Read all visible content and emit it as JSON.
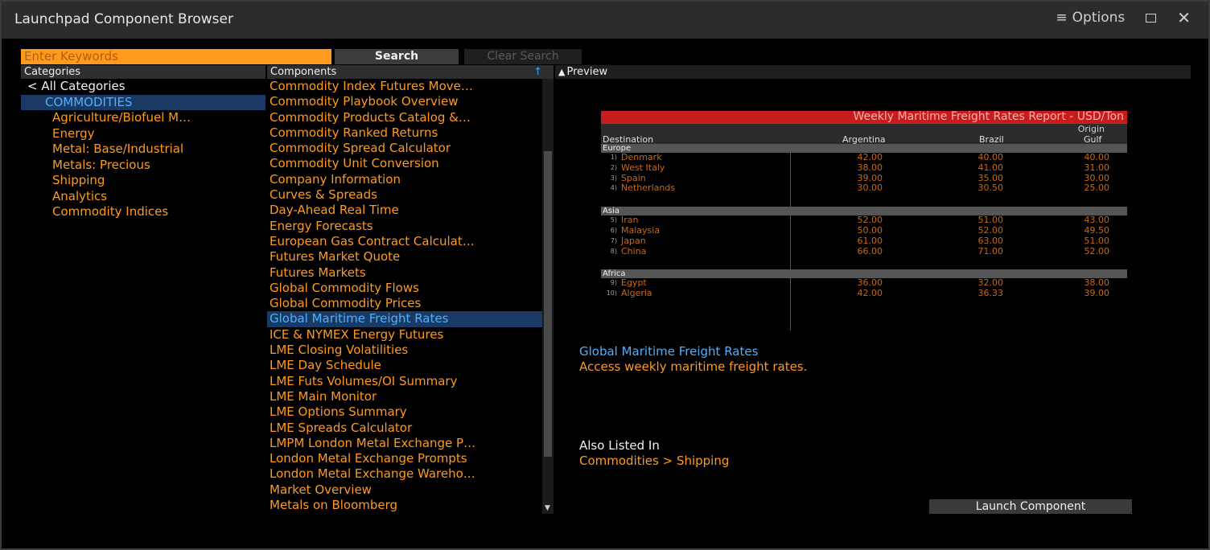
{
  "window": {
    "title": "Launchpad Component Browser",
    "options_label": "Options",
    "menu_icon": "hamburger-icon",
    "maximize_icon": "square-icon",
    "close_icon": "close-icon"
  },
  "search": {
    "placeholder": "Enter Keywords",
    "search_label": "Search",
    "clear_label": "Clear Search"
  },
  "headers": {
    "categories": "Categories",
    "components": "Components",
    "preview": "Preview",
    "sort_icon": "up-arrow-icon"
  },
  "categories": {
    "back": "< All Categories",
    "selected": "COMMODITIES",
    "items": [
      "Agriculture/Biofuel M…",
      "Energy",
      "Metal: Base/Industrial",
      "Metals: Precious",
      "Shipping",
      "Analytics",
      "Commodity Indices"
    ]
  },
  "components": {
    "selected_index": 15,
    "items": [
      "Commodity Index Futures Move…",
      "Commodity Playbook Overview",
      "Commodity Products Catalog &…",
      "Commodity Ranked Returns",
      "Commodity Spread Calculator",
      "Commodity Unit Conversion",
      "Company Information",
      "Curves & Spreads",
      "Day-Ahead Real Time",
      "Energy Forecasts",
      "European Gas Contract Calculat…",
      "Futures Market Quote",
      "Futures Markets",
      "Global Commodity Flows",
      "Global Commodity Prices",
      "Global Maritime Freight Rates",
      "ICE & NYMEX Energy Futures",
      "LME Closing Volatilities",
      "LME Day Schedule",
      "LME Futs Volumes/OI Summary",
      "LME Main Monitor",
      "LME Options Summary",
      "LME Spreads Calculator",
      "LMPM London Metal Exchange P…",
      "London Metal Exchange Prompts",
      "London Metal Exchange Wareho…",
      "Market Overview",
      "Metals on Bloomberg"
    ]
  },
  "preview": {
    "report": {
      "title": "Weekly Maritime Freight Rates Report - USD/Ton",
      "origin_label": "Origin",
      "columns": [
        "Destination",
        "Argentina",
        "Brazil",
        "Gulf"
      ],
      "sections": [
        {
          "name": "Europe",
          "rows": [
            {
              "num": "1)",
              "dest": "Denmark",
              "vals": [
                "42.00",
                "40.00",
                "40.00"
              ]
            },
            {
              "num": "2)",
              "dest": "West Italy",
              "vals": [
                "38.00",
                "41.00",
                "31.00"
              ]
            },
            {
              "num": "3)",
              "dest": "Spain",
              "vals": [
                "39.00",
                "35.00",
                "30.00"
              ]
            },
            {
              "num": "4)",
              "dest": "Netherlands",
              "vals": [
                "30.00",
                "30.50",
                "25.00"
              ]
            }
          ]
        },
        {
          "name": "Asia",
          "rows": [
            {
              "num": "5)",
              "dest": "Iran",
              "vals": [
                "52.00",
                "51.00",
                "43.00"
              ]
            },
            {
              "num": "6)",
              "dest": "Malaysia",
              "vals": [
                "50.00",
                "52.00",
                "49.50"
              ]
            },
            {
              "num": "7)",
              "dest": "Japan",
              "vals": [
                "61.00",
                "63.00",
                "51.00"
              ]
            },
            {
              "num": "8)",
              "dest": "China",
              "vals": [
                "66.00",
                "71.00",
                "52.00"
              ]
            }
          ]
        },
        {
          "name": "Africa",
          "rows": [
            {
              "num": "9)",
              "dest": "Egypt",
              "vals": [
                "36.00",
                "32.00",
                "38.00"
              ]
            },
            {
              "num": "10)",
              "dest": "Algeria",
              "vals": [
                "42.00",
                "36.33",
                "39.00"
              ]
            }
          ]
        }
      ]
    },
    "component_title": "Global Maritime Freight Rates",
    "component_desc": "Access weekly maritime freight rates.",
    "also_listed_label": "Also Listed In",
    "also_listed_link": "Commodities > Shipping",
    "launch_label": "Launch Component"
  },
  "colors": {
    "accent_orange": "#ff9a1f",
    "selection_blue": "#1a3a63",
    "link_blue": "#4fb0ff",
    "report_red": "#c81b1b"
  }
}
